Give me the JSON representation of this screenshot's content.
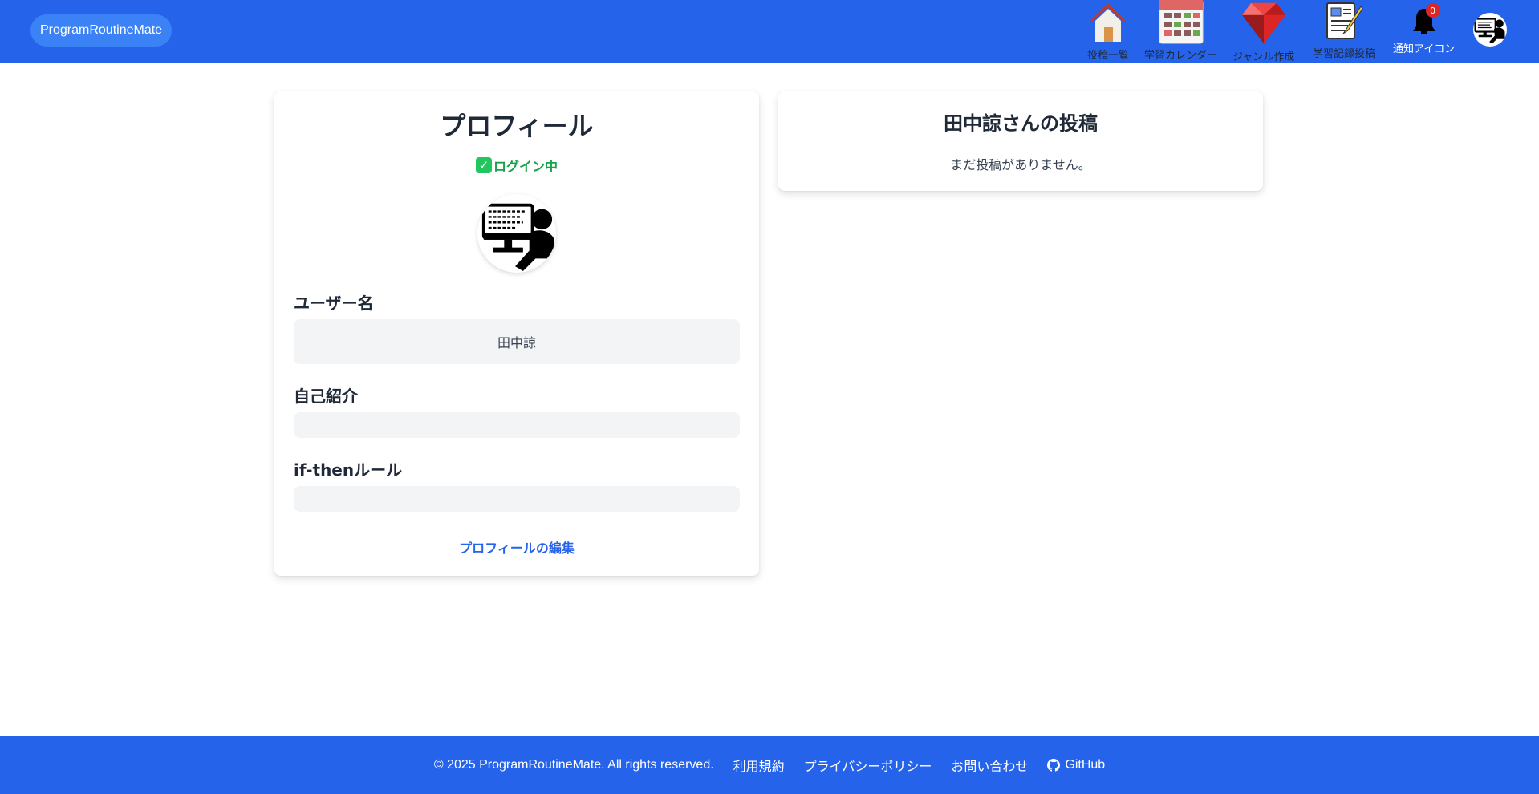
{
  "header": {
    "brand": "ProgramRoutineMate",
    "nav": [
      {
        "label": "投稿一覧",
        "icon": "house-icon"
      },
      {
        "label": "学習カレンダー",
        "icon": "calendar-icon"
      },
      {
        "label": "ジャンル作成",
        "icon": "ruby-gem-icon"
      },
      {
        "label": "学習記録投稿",
        "icon": "document-edit-icon"
      },
      {
        "label": "通知アイコン",
        "icon": "notification-icon"
      }
    ],
    "notification_count": "0",
    "avatar_icon": "user-avatar-icon"
  },
  "profile": {
    "title": "プロフィール",
    "login_status": "ログイン中",
    "username_label": "ユーザー名",
    "username_value": "田中諒",
    "bio_label": "自己紹介",
    "bio_value": "",
    "ifthen_label": "if-thenルール",
    "ifthen_value": "",
    "edit_link": "プロフィールの編集"
  },
  "posts": {
    "title": "田中諒さんの投稿",
    "empty_message": "まだ投稿がありません。"
  },
  "footer": {
    "copyright": "© 2025 ProgramRoutineMate. All rights reserved.",
    "links": [
      "利用規約",
      "プライバシーポリシー",
      "お問い合わせ",
      "GitHub"
    ]
  },
  "colors": {
    "primary": "#2563eb",
    "brand_pill": "#3b82f6",
    "success": "#16a34a",
    "field_bg": "#f3f4f6",
    "badge": "#dc2626"
  }
}
